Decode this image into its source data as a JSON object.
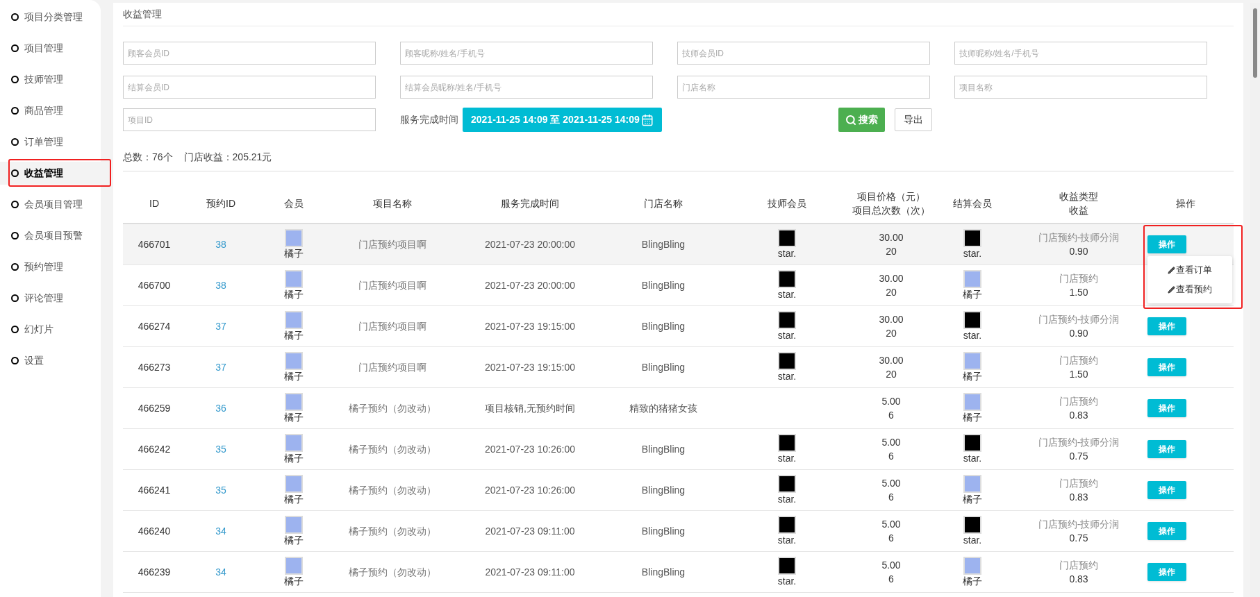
{
  "sidebar": {
    "items": [
      {
        "label": "项目分类管理",
        "selected": false,
        "highlighted": false
      },
      {
        "label": "项目管理",
        "selected": false,
        "highlighted": false
      },
      {
        "label": "技师管理",
        "selected": false,
        "highlighted": false
      },
      {
        "label": "商品管理",
        "selected": false,
        "highlighted": false
      },
      {
        "label": "订单管理",
        "selected": false,
        "highlighted": false
      },
      {
        "label": "收益管理",
        "selected": true,
        "highlighted": true
      },
      {
        "label": "会员项目管理",
        "selected": false,
        "highlighted": false
      },
      {
        "label": "会员项目预警",
        "selected": false,
        "highlighted": false
      },
      {
        "label": "预约管理",
        "selected": false,
        "highlighted": false
      },
      {
        "label": "评论管理",
        "selected": false,
        "highlighted": false
      },
      {
        "label": "幻灯片",
        "selected": false,
        "highlighted": false
      },
      {
        "label": "设置",
        "selected": false,
        "highlighted": false
      }
    ]
  },
  "page_title": "收益管理",
  "filters": {
    "fields": [
      {
        "placeholder": "顾客会员ID"
      },
      {
        "placeholder": "顾客昵称/姓名/手机号"
      },
      {
        "placeholder": "技师会员ID"
      },
      {
        "placeholder": "技师昵称/姓名/手机号"
      },
      {
        "placeholder": "结算会员ID"
      },
      {
        "placeholder": "结算会员昵称/姓名/手机号"
      },
      {
        "placeholder": "门店名称"
      },
      {
        "placeholder": "项目名称"
      },
      {
        "placeholder": "项目ID"
      }
    ],
    "date_label": "服务完成时间",
    "date_value": "2021-11-25 14:09 至 2021-11-25 14:09",
    "search_button": "搜索",
    "export_button": "导出"
  },
  "summary": [
    "总数：76个",
    "门店收益：205.21元"
  ],
  "table": {
    "columns": [
      {
        "lines": [
          "ID"
        ]
      },
      {
        "lines": [
          "预约ID"
        ]
      },
      {
        "lines": [
          "会员"
        ]
      },
      {
        "lines": [
          "项目名称"
        ]
      },
      {
        "lines": [
          "服务完成时间"
        ]
      },
      {
        "lines": [
          "门店名称"
        ]
      },
      {
        "lines": [
          "技师会员"
        ]
      },
      {
        "lines": [
          "项目价格（元）",
          "项目总次数（次）"
        ]
      },
      {
        "lines": [
          "结算会员"
        ]
      },
      {
        "lines": [
          "收益类型",
          "收益"
        ]
      },
      {
        "lines": [
          "操作"
        ]
      }
    ],
    "menu": {
      "items": [
        "查看订单",
        "查看预约"
      ],
      "highlighted": true
    },
    "rows": [
      {
        "id": "466701",
        "appointment_id": "38",
        "member": {
          "name": "橘子",
          "kind": "cartoon"
        },
        "project": "门店预约项目啊",
        "finish_time": "2021-07-23 20:00:00",
        "store": "BlingBling",
        "technician": {
          "name": "star.",
          "kind": "dark"
        },
        "price": "30.00",
        "count": "20",
        "settler": {
          "name": "star.",
          "kind": "dark"
        },
        "income_type": "门店预约-技师分润",
        "income": "0.90",
        "action": "操作",
        "menu_open": true
      },
      {
        "id": "466700",
        "appointment_id": "38",
        "member": {
          "name": "橘子",
          "kind": "cartoon"
        },
        "project": "门店预约项目啊",
        "finish_time": "2021-07-23 20:00:00",
        "store": "BlingBling",
        "technician": {
          "name": "star.",
          "kind": "dark"
        },
        "price": "30.00",
        "count": "20",
        "settler": {
          "name": "橘子",
          "kind": "cartoon"
        },
        "income_type": "门店预约",
        "income": "1.50",
        "menu_open": false
      },
      {
        "id": "466274",
        "appointment_id": "37",
        "member": {
          "name": "橘子",
          "kind": "cartoon"
        },
        "project": "门店预约项目啊",
        "finish_time": "2021-07-23 19:15:00",
        "store": "BlingBling",
        "technician": {
          "name": "star.",
          "kind": "dark"
        },
        "price": "30.00",
        "count": "20",
        "settler": {
          "name": "star.",
          "kind": "dark"
        },
        "income_type": "门店预约-技师分润",
        "income": "0.90",
        "action": "操作",
        "menu_open": false
      },
      {
        "id": "466273",
        "appointment_id": "37",
        "member": {
          "name": "橘子",
          "kind": "cartoon"
        },
        "project": "门店预约项目啊",
        "finish_time": "2021-07-23 19:15:00",
        "store": "BlingBling",
        "technician": {
          "name": "star.",
          "kind": "dark"
        },
        "price": "30.00",
        "count": "20",
        "settler": {
          "name": "橘子",
          "kind": "cartoon"
        },
        "income_type": "门店预约",
        "income": "1.50",
        "action": "操作",
        "menu_open": false
      },
      {
        "id": "466259",
        "appointment_id": "36",
        "member": {
          "name": "橘子",
          "kind": "cartoon"
        },
        "project": "橘子预约（勿改动）",
        "finish_time": "项目核销,无预约时间",
        "store": "精致的猪猪女孩",
        "price": "5.00",
        "count": "6",
        "settler": {
          "name": "橘子",
          "kind": "cartoon"
        },
        "income_type": "门店预约",
        "income": "0.83",
        "action": "操作",
        "menu_open": false
      },
      {
        "id": "466242",
        "appointment_id": "35",
        "member": {
          "name": "橘子",
          "kind": "cartoon"
        },
        "project": "橘子预约（勿改动）",
        "finish_time": "2021-07-23 10:26:00",
        "store": "BlingBling",
        "technician": {
          "name": "star.",
          "kind": "dark"
        },
        "price": "5.00",
        "count": "6",
        "settler": {
          "name": "star.",
          "kind": "dark"
        },
        "income_type": "门店预约-技师分润",
        "income": "0.75",
        "action": "操作",
        "menu_open": false
      },
      {
        "id": "466241",
        "appointment_id": "35",
        "member": {
          "name": "橘子",
          "kind": "cartoon"
        },
        "project": "橘子预约（勿改动）",
        "finish_time": "2021-07-23 10:26:00",
        "store": "BlingBling",
        "technician": {
          "name": "star.",
          "kind": "dark"
        },
        "price": "5.00",
        "count": "6",
        "settler": {
          "name": "橘子",
          "kind": "cartoon"
        },
        "income_type": "门店预约",
        "income": "0.83",
        "action": "操作",
        "menu_open": false
      },
      {
        "id": "466240",
        "appointment_id": "34",
        "member": {
          "name": "橘子",
          "kind": "cartoon"
        },
        "project": "橘子预约（勿改动）",
        "finish_time": "2021-07-23 09:11:00",
        "store": "BlingBling",
        "technician": {
          "name": "star.",
          "kind": "dark"
        },
        "price": "5.00",
        "count": "6",
        "settler": {
          "name": "star.",
          "kind": "dark"
        },
        "income_type": "门店预约-技师分润",
        "income": "0.75",
        "action": "操作",
        "menu_open": false
      },
      {
        "id": "466239",
        "appointment_id": "34",
        "member": {
          "name": "橘子",
          "kind": "cartoon"
        },
        "project": "橘子预约（勿改动）",
        "finish_time": "2021-07-23 09:11:00",
        "store": "BlingBling",
        "technician": {
          "name": "star.",
          "kind": "dark"
        },
        "price": "5.00",
        "count": "6",
        "settler": {
          "name": "橘子",
          "kind": "cartoon"
        },
        "income_type": "门店预约",
        "income": "0.83",
        "action": "操作",
        "menu_open": false
      }
    ]
  }
}
